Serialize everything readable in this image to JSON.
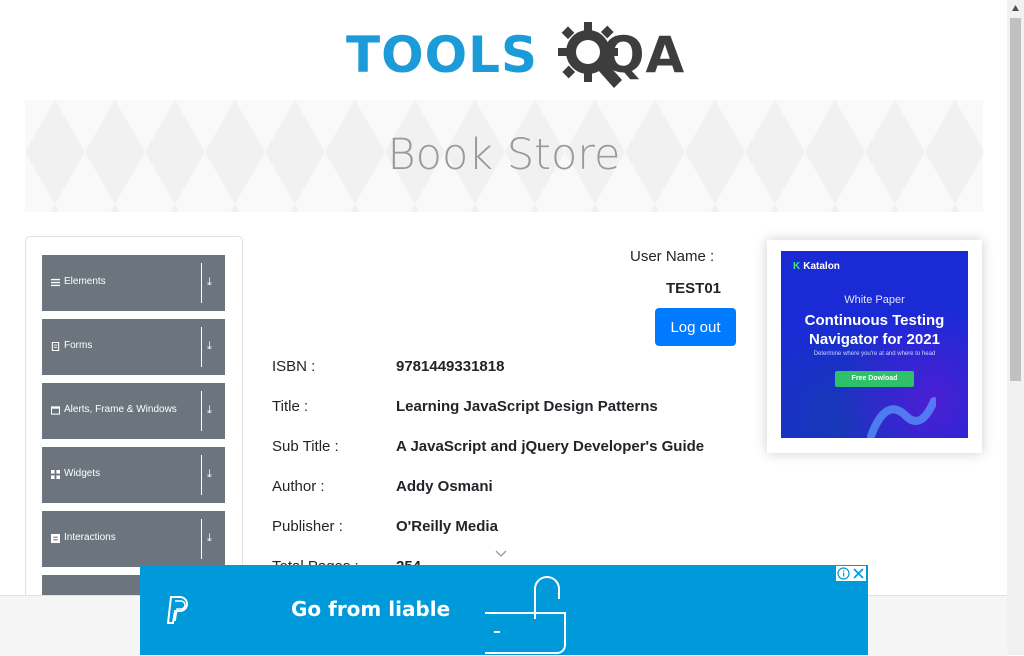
{
  "header": {
    "logo_left": "TOOLS",
    "logo_right": "QA",
    "banner_title": "Book Store"
  },
  "sidebar": {
    "groups": [
      {
        "label": "Elements",
        "icon": "list-icon"
      },
      {
        "label": "Forms",
        "icon": "form-icon"
      },
      {
        "label": "Alerts, Frame & Windows",
        "icon": "window-icon"
      },
      {
        "label": "Widgets",
        "icon": "widgets-icon"
      },
      {
        "label": "Interactions",
        "icon": "interactions-icon"
      }
    ],
    "arrow": "⤓"
  },
  "profile": {
    "user_name_label": "User Name :",
    "user_name_value": "TEST01",
    "logout_label": "Log out"
  },
  "book": {
    "rows": [
      {
        "label": "ISBN :",
        "value": "9781449331818"
      },
      {
        "label": "Title :",
        "value": "Learning JavaScript Design Patterns"
      },
      {
        "label": "Sub Title :",
        "value": "A JavaScript and jQuery Developer's Guide"
      },
      {
        "label": "Author :",
        "value": "Addy Osmani"
      },
      {
        "label": "Publisher :",
        "value": "O'Reilly Media"
      },
      {
        "label": "Total Pages :",
        "value": "254"
      }
    ]
  },
  "ad_right": {
    "brand": "Katalon",
    "kicker": "White Paper",
    "headline_line1": "Continuous Testing",
    "headline_line2": "Navigator for 2021",
    "subtext": "Determine where you're at and where to head",
    "cta": "Free Dowload"
  },
  "ad_bottom": {
    "text": "Go from liable"
  },
  "colors": {
    "accent": "#007bff",
    "sidebar_group": "#6c757d",
    "logo_blue": "#1b9bd7",
    "logo_dark": "#3d3d3d",
    "ad_bottom_bg": "#0099d9",
    "ad_right_bg": "#1a2bd6"
  }
}
